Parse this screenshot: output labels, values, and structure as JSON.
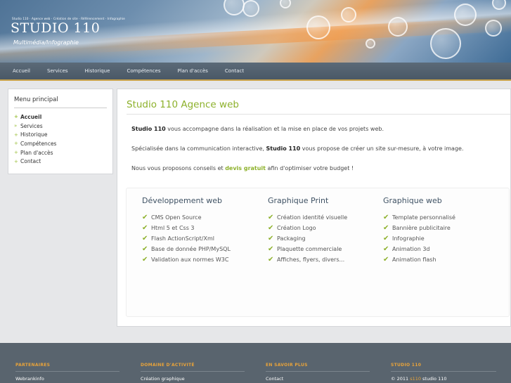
{
  "header": {
    "breadcrumb": "Studio 110 · Agence web · Création de site · Référencement · Infographie",
    "logo": "STUDIO 110",
    "tagline": "Multimédia/Infographie"
  },
  "nav": {
    "items": [
      "Accueil",
      "Services",
      "Historique",
      "Compétences",
      "Plan d'accès",
      "Contact"
    ]
  },
  "sidebar": {
    "title": "Menu principal",
    "items": [
      "Accueil",
      "Services",
      "Historique",
      "Compétences",
      "Plan d'accès",
      "Contact"
    ],
    "active": "Accueil"
  },
  "main": {
    "title": "Studio 110 Agence web",
    "p1_brand": "Studio 110",
    "p1_text": " vous accompagne dans la réalisation et la mise en place de vos projets web.",
    "p2_pre": "Spécialisée dans la communication interactive, ",
    "p2_brand": "Studio 110",
    "p2_post": " vous propose de créer un site sur-mesure, à votre image.",
    "p3_pre": "Nous vous proposons conseils et ",
    "p3_link": "devis gratuit",
    "p3_post": " afin d'optimiser votre budget !",
    "columns": [
      {
        "title": "Développement web",
        "items": [
          "CMS Open Source",
          "Html 5 et Css 3",
          "Flash ActionScript/Xml",
          "Base de donnée PHP/MySQL",
          "Validation aux normes W3C"
        ]
      },
      {
        "title": "Graphique Print",
        "items": [
          "Création identité visuelle",
          "Création Logo",
          "Packaging",
          "Plaquette commerciale",
          "Affiches, flyers, divers..."
        ]
      },
      {
        "title": "Graphique web",
        "items": [
          "Template personnalisé",
          "Bannière publicitaire",
          "Infographie",
          "Animation 3d",
          "Animation flash"
        ]
      }
    ]
  },
  "footer": {
    "cols": [
      {
        "title": "PARTENAIRES",
        "text": "Webrankinfo"
      },
      {
        "title": "DOMAINE D'ACTIVITÉ",
        "text": "Création graphique"
      },
      {
        "title": "EN SAVOIR PLUS",
        "text": "Contact"
      },
      {
        "title": "STUDIO 110",
        "text_pre": "© 2011 ",
        "text_accent": "s110",
        "text_post": " studio 110"
      }
    ]
  },
  "colors": {
    "accent_green": "#8db12b",
    "nav_bg": "#4f5d6a",
    "footer_bg": "#59646e",
    "footer_accent": "#e8a33a"
  }
}
